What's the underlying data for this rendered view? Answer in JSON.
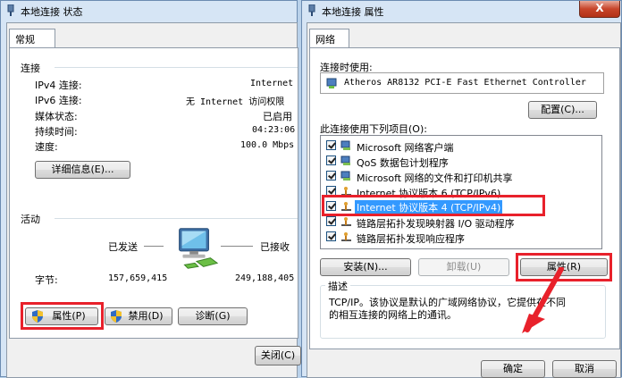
{
  "status_window": {
    "title": "本地连接 状态",
    "tab": "常规",
    "connection": {
      "heading": "连接",
      "rows": [
        {
          "label": "IPv4 连接:",
          "value": "Internet"
        },
        {
          "label": "IPv6 连接:",
          "value": "无 Internet 访问权限"
        },
        {
          "label": "媒体状态:",
          "value": "已启用"
        },
        {
          "label": "持续时间:",
          "value": "04:23:06"
        },
        {
          "label": "速度:",
          "value": "100.0 Mbps"
        }
      ],
      "details_button": "详细信息(E)..."
    },
    "activity": {
      "heading": "活动",
      "sent_label": "已发送",
      "received_label": "已接收",
      "bytes_label": "字节:",
      "sent_bytes": "157,659,415",
      "received_bytes": "249,188,405"
    },
    "buttons": {
      "properties": "属性(P)",
      "disable": "禁用(D)",
      "diagnose": "诊断(G)",
      "close": "关闭(C)"
    }
  },
  "props_window": {
    "title": "本地连接 属性",
    "tab": "网络",
    "connect_using_label": "连接时使用:",
    "adapter_name": "Atheros AR8132 PCI-E Fast Ethernet Controller",
    "configure_button": "配置(C)...",
    "items_label": "此连接使用下列项目(O):",
    "items": [
      {
        "text": "Microsoft 网络客户端",
        "icon": "network-client-icon"
      },
      {
        "text": "QoS 数据包计划程序",
        "icon": "qos-icon"
      },
      {
        "text": "Microsoft 网络的文件和打印机共享",
        "icon": "file-share-icon"
      },
      {
        "text": "Internet 协议版本 6 (TCP/IPv6)",
        "icon": "protocol-icon"
      },
      {
        "text": "Internet 协议版本 4 (TCP/IPv4)",
        "icon": "protocol-icon"
      },
      {
        "text": "链路层拓扑发现映射器 I/O 驱动程序",
        "icon": "protocol-icon"
      },
      {
        "text": "链路层拓扑发现响应程序",
        "icon": "protocol-icon"
      }
    ],
    "install_button": "安装(N)...",
    "uninstall_button": "卸载(U)",
    "properties_button": "属性(R)",
    "description_heading": "描述",
    "description_line1": "TCP/IP。该协议是默认的广域网络协议，它提供在不同",
    "description_line2": "的相互连接的网络上的通讯。",
    "ok_button": "确定",
    "cancel_button": "取消",
    "close_glyph": "X"
  },
  "colors": {
    "highlight": "#3399ff",
    "annotation_red": "#e8212b"
  }
}
